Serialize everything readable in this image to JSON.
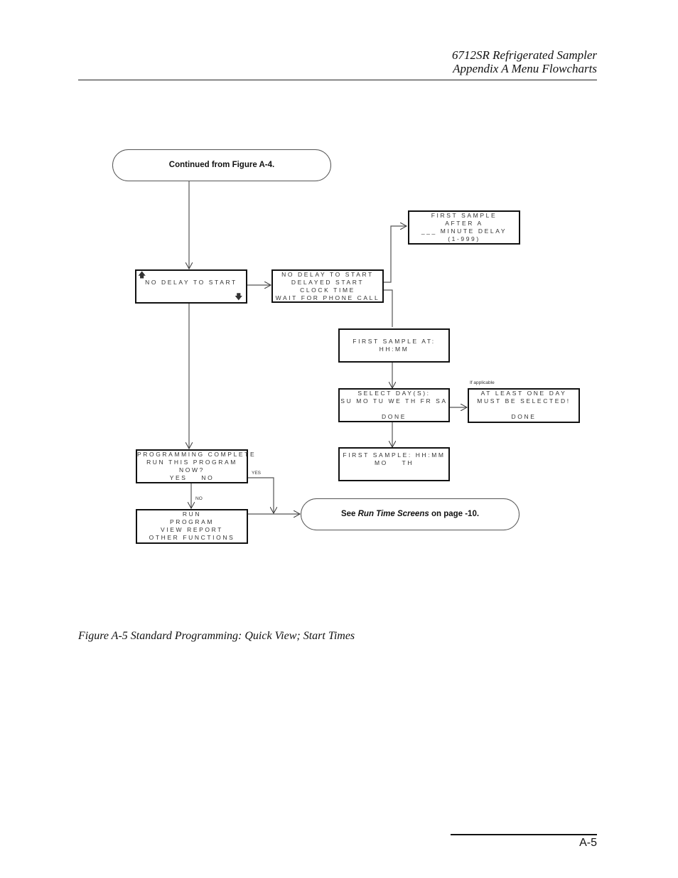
{
  "header": {
    "line1": "6712SR Refrigerated Sampler",
    "line2": "Appendix A  Menu Flowcharts"
  },
  "flowchart": {
    "start_terminal": "Continued from Figure A-4.",
    "end_terminal": {
      "prefix": "See ",
      "italic": "Run Time Screens",
      "suffix": " on page -10."
    },
    "boxes": {
      "no_delay": {
        "lines": [
          "NO DELAY TO START"
        ],
        "scroll_up_icon": "arrow-up",
        "scroll_down_icon": "arrow-down"
      },
      "start_options": {
        "lines": [
          "NO DELAY TO START",
          "DELAYED START",
          "CLOCK TIME",
          "WAIT FOR PHONE CALL"
        ]
      },
      "minute_delay": {
        "lines": [
          "FIRST SAMPLE",
          "AFTER A",
          "___ MINUTE DELAY",
          "(1-999)"
        ]
      },
      "first_sample_at": {
        "lines": [
          "FIRST SAMPLE AT:",
          "HH:MM"
        ]
      },
      "select_days": {
        "lines": [
          "SELECT DAY(S):",
          "SU MO TU WE TH FR SA",
          "",
          "DONE"
        ]
      },
      "at_least_one": {
        "lines": [
          "AT LEAST ONE DAY",
          "MUST BE SELECTED!",
          "",
          "DONE"
        ],
        "note": "If applicable"
      },
      "first_sample_summary": {
        "lines": [
          "FIRST SAMPLE: HH:MM",
          "MO    TH"
        ]
      },
      "programming_complete": {
        "lines": [
          "PROGRAMMING COMPLETE",
          "RUN THIS PROGRAM",
          "NOW?",
          "YES    NO"
        ]
      },
      "run_menu": {
        "lines": [
          "RUN",
          "PROGRAM",
          "VIEW REPORT",
          "OTHER FUNCTIONS"
        ]
      }
    },
    "edge_labels": {
      "yes": "YES",
      "no": "NO"
    }
  },
  "caption": "Figure A-5  Standard Programming: Quick View; Start Times",
  "footer": {
    "page_number": "A-5"
  }
}
